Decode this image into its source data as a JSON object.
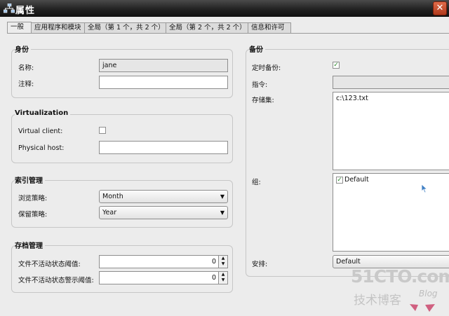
{
  "window": {
    "title": "属性",
    "close_glyph": "✕"
  },
  "tabs": [
    {
      "label": "一般",
      "active": true
    },
    {
      "label": "应用程序和模块",
      "active": false
    },
    {
      "label": "全局（第 1 个，共 2 个）",
      "active": false
    },
    {
      "label": "全局（第 2 个，共 2 个）",
      "active": false
    },
    {
      "label": "信息和许可",
      "active": false
    }
  ],
  "identity": {
    "title": "身份",
    "name_label": "名称:",
    "name_value": "jane",
    "comment_label": "注释:",
    "comment_value": ""
  },
  "virtualization": {
    "title": "Virtualization",
    "client_label": "Virtual client:",
    "client_checked": false,
    "host_label": "Physical host:",
    "host_value": ""
  },
  "index_mgmt": {
    "title": "索引管理",
    "browse_label": "浏览策略:",
    "browse_value": "Month",
    "retention_label": "保留策略:",
    "retention_value": "Year"
  },
  "archive_mgmt": {
    "title": "存档管理",
    "inactive_label": "文件不活动状态阈值:",
    "inactive_value": "0",
    "warning_label": "文件不活动状态警示阈值:",
    "warning_value": "0"
  },
  "backup": {
    "title": "备份",
    "scheduled_label": "定时备份:",
    "scheduled_checked": true,
    "command_label": "指令:",
    "command_value": "",
    "saveset_label": "存储集:",
    "saveset_value": "c:\\123.txt",
    "group_label": "组:",
    "group_item": "Default",
    "group_item_checked": true,
    "schedule_label": "安排:",
    "schedule_value": "Default"
  },
  "watermark": {
    "main": "51CTO.com",
    "sub": "技术博客",
    "blog": "Blog"
  },
  "colors": {
    "titlebar": "#1c1c1c",
    "panel": "#ececec",
    "check": "#2a8a2a"
  }
}
